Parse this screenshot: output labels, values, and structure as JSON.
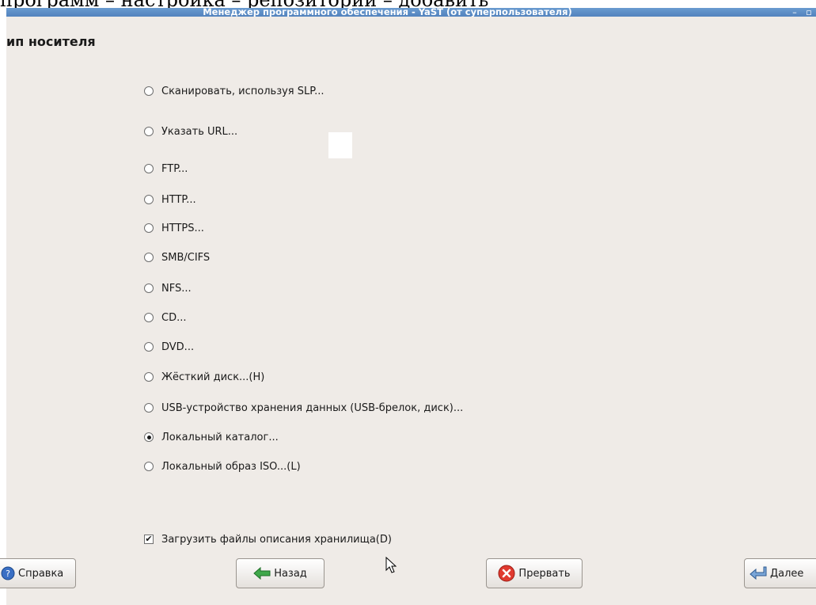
{
  "document": {
    "caption": "программ – настройка – репозитории – добавить"
  },
  "window": {
    "title": "Менеджер программного обеспечения - YaST (от суперпользователя)",
    "minimize_glyph": "–",
    "maximize_glyph": "▫"
  },
  "page": {
    "heading": "ип носителя"
  },
  "media_types": {
    "selected": "Локальный каталог...",
    "options": [
      {
        "label": "Сканировать, используя SLP...",
        "checked": false
      },
      {
        "label": "Указать URL...",
        "checked": false
      },
      {
        "label": "FTP...",
        "checked": false
      },
      {
        "label": "HTTP...",
        "checked": false
      },
      {
        "label": "HTTPS...",
        "checked": false
      },
      {
        "label": "SMB/CIFS",
        "checked": false
      },
      {
        "label": "NFS...",
        "checked": false
      },
      {
        "label": "CD...",
        "checked": false
      },
      {
        "label": "DVD...",
        "checked": false
      },
      {
        "label": "Жёсткий диск...(H)",
        "checked": false
      },
      {
        "label": "USB-устройство хранения данных (USB-брелок, диск)...",
        "checked": false
      },
      {
        "label": "Локальный каталог...",
        "checked": true
      },
      {
        "label": "Локальный образ ISO...(L)",
        "checked": false
      }
    ]
  },
  "download_checkbox": {
    "label": "Загрузить файлы описания хранилища(D)",
    "checked": true,
    "check_glyph": "✔"
  },
  "buttons": {
    "help": "Справка",
    "back": "Назад",
    "abort": "Прервать",
    "next": "Далее"
  },
  "colors": {
    "window_bg": "#efebe7",
    "titlebar": "#4f7fbd",
    "abort_icon": "#e03a2f",
    "back_icon": "#3fa84a",
    "help_icon": "#3a6fc4",
    "next_icon": "#7aa6d8"
  }
}
